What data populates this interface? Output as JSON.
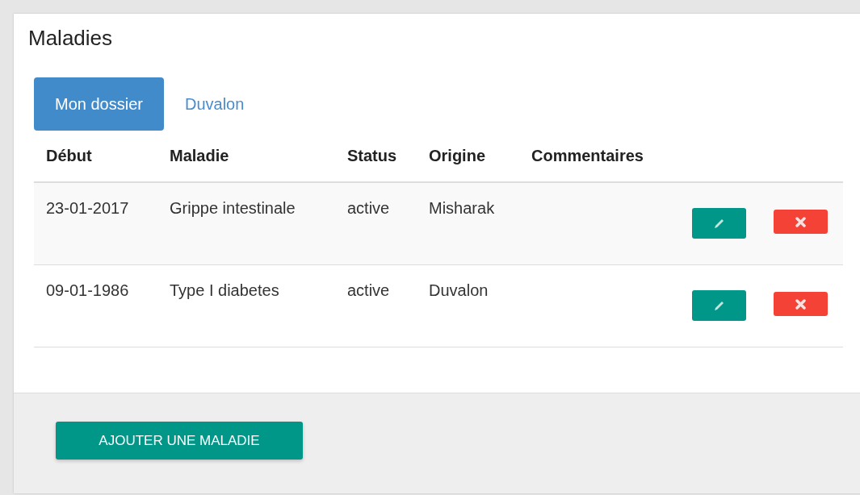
{
  "title": "Maladies",
  "tabs": [
    {
      "label": "Mon dossier",
      "selected": true
    },
    {
      "label": "Duvalon",
      "selected": false
    }
  ],
  "table": {
    "columns": [
      "Début",
      "Maladie",
      "Status",
      "Origine",
      "Commentaires"
    ],
    "rows": [
      {
        "cells": [
          "23-01-2017",
          "Grippe intestinale",
          "active",
          "Misharak",
          ""
        ]
      },
      {
        "cells": [
          "09-01-1986",
          "Type I diabetes",
          "active",
          "Duvalon",
          ""
        ]
      }
    ]
  },
  "footer": {
    "button": "AJOUTER UNE MALADIE"
  }
}
